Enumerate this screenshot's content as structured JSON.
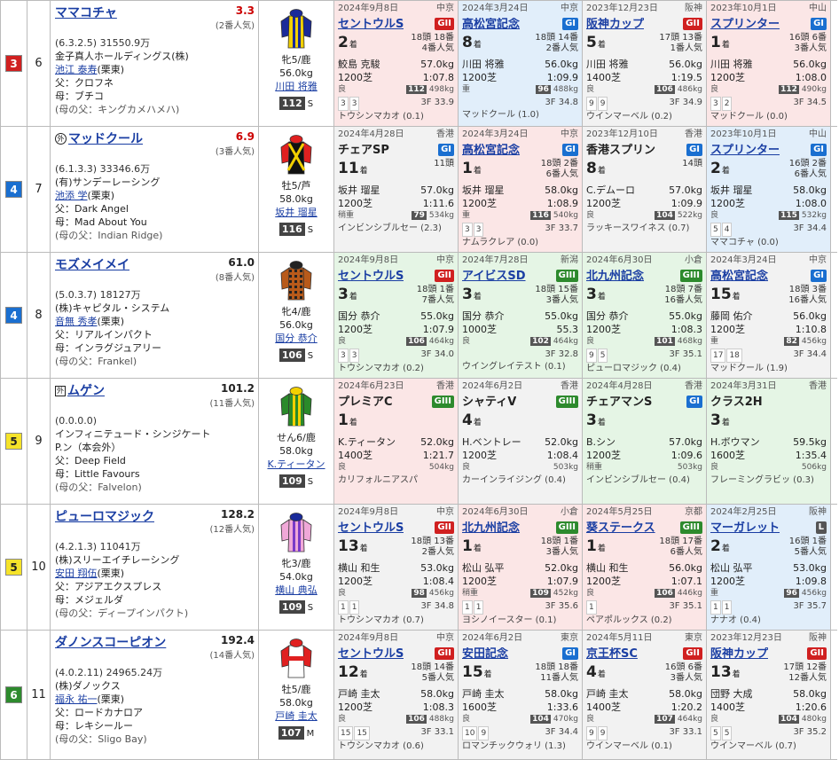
{
  "horses": [
    {
      "waku": "3",
      "waku_bg": "#d02020",
      "waku_fg": "#fff",
      "uma": "6",
      "name": "ママコチャ",
      "gaikoku": "",
      "odds": "3.3",
      "odds_red": true,
      "ninki": "(2番人気)",
      "record": "(6.3.2.5)",
      "prize": "31550.9万",
      "owner": "金子真人ホールディングス(株)",
      "trainer": "池江 泰寿",
      "region": "(栗東)",
      "sire": "父：クロフネ",
      "dam": "母：ブチコ",
      "damsire": "(母の父：キングカメハメハ)",
      "sexage": "牝5/鹿",
      "weight": "56.0kg",
      "jockey": "川田 将雅",
      "rating": "112",
      "rating_suffix": "S",
      "silk": {
        "body": "#f2d000",
        "sleeve": "#1a2a9a",
        "cap": "#1a2a9a",
        "pattern": "stripe",
        "stripe": "#1a2a9a"
      },
      "past": [
        {
          "date": "2024年9月8日",
          "venue": "中京",
          "race": "セントウルS",
          "grade": "GII",
          "g": "g2",
          "bg": "bg-red",
          "link": true,
          "pos": "2",
          "fs_line1": "18頭 18番",
          "fs_line2": "4番人気",
          "jockey": "鮫島 克駿",
          "kg": "57.0kg",
          "dist": "1200芝",
          "time": "1:07.8",
          "track": "良",
          "w_badge": "112",
          "bw": "498kg",
          "c1": "3",
          "c2": "3",
          "last3f": "3F 33.9",
          "winner": "トウシンマカオ (0.1)"
        },
        {
          "date": "2024年3月24日",
          "venue": "中京",
          "race": "高松宮記念",
          "grade": "GI",
          "g": "g1",
          "bg": "bg-blue",
          "link": true,
          "pos": "8",
          "fs_line1": "18頭 14番",
          "fs_line2": "2番人気",
          "jockey": "川田 将雅",
          "kg": "56.0kg",
          "dist": "1200芝",
          "time": "1:09.9",
          "track": "重",
          "w_badge": "96",
          "bw": "488kg",
          "c1": "",
          "c2": "",
          "last3f": "3F 34.8",
          "winner": "マッドクール (1.0)"
        },
        {
          "date": "2023年12月23日",
          "venue": "阪神",
          "race": "阪神カップ",
          "grade": "GII",
          "g": "g2",
          "bg": "bg-gray",
          "link": true,
          "pos": "5",
          "fs_line1": "17頭 13番",
          "fs_line2": "1番人気",
          "jockey": "川田 将雅",
          "kg": "56.0kg",
          "dist": "1400芝",
          "time": "1:19.5",
          "track": "良",
          "w_badge": "106",
          "bw": "486kg",
          "c1": "9",
          "c2": "9",
          "last3f": "3F 34.9",
          "winner": "ウインマーベル (0.2)"
        },
        {
          "date": "2023年10月1日",
          "venue": "中山",
          "race": "スプリンター",
          "grade": "GI",
          "g": "g1",
          "bg": "bg-red",
          "link": true,
          "pos": "1",
          "fs_line1": "16頭 6番",
          "fs_line2": "3番人気",
          "jockey": "川田 将雅",
          "kg": "56.0kg",
          "dist": "1200芝",
          "time": "1:08.0",
          "track": "良",
          "w_badge": "112",
          "bw": "490kg",
          "c1": "3",
          "c2": "2",
          "last3f": "3F 34.5",
          "winner": "マッドクール (0.0)"
        }
      ]
    },
    {
      "waku": "4",
      "waku_bg": "#1a6fd0",
      "waku_fg": "#fff",
      "uma": "7",
      "name": "マッドクール",
      "gaikoku": "circle",
      "odds": "6.9",
      "odds_red": true,
      "ninki": "(3番人気)",
      "record": "(6.1.3.3)",
      "prize": "33346.6万",
      "owner": "(有)サンデーレーシング",
      "trainer": "池添 学",
      "region": "(栗東)",
      "sire": "父：Dark Angel",
      "dam": "母：Mad About You",
      "damsire": "(母の父：Indian Ridge)",
      "sexage": "牡5/芦",
      "weight": "58.0kg",
      "jockey": "坂井 瑠星",
      "rating": "116",
      "rating_suffix": "S",
      "silk": {
        "body": "#111",
        "sleeve": "#e02020",
        "cap": "#e02020",
        "pattern": "cross",
        "stripe": "#f2d000"
      },
      "past": [
        {
          "date": "2024年4月28日",
          "venue": "香港",
          "race": "チェアSP",
          "grade": "GI",
          "g": "g1",
          "bg": "bg-gray",
          "link": false,
          "pos": "11",
          "fs_line1": "11頭",
          "fs_line2": "",
          "jockey": "坂井 瑠星",
          "kg": "57.0kg",
          "dist": "1200芝",
          "time": "1:11.6",
          "track": "稍重",
          "w_badge": "79",
          "bw": "534kg",
          "c1": "",
          "c2": "",
          "last3f": "",
          "winner": "インビンシブルセー (2.3)"
        },
        {
          "date": "2024年3月24日",
          "venue": "中京",
          "race": "高松宮記念",
          "grade": "GI",
          "g": "g1",
          "bg": "bg-red",
          "link": true,
          "pos": "1",
          "fs_line1": "18頭 2番",
          "fs_line2": "6番人気",
          "jockey": "坂井 瑠星",
          "kg": "58.0kg",
          "dist": "1200芝",
          "time": "1:08.9",
          "track": "重",
          "w_badge": "116",
          "bw": "540kg",
          "c1": "3",
          "c2": "3",
          "last3f": "3F 33.7",
          "winner": "ナムラクレア (0.0)"
        },
        {
          "date": "2023年12月10日",
          "venue": "香港",
          "race": "香港スプリン",
          "grade": "GI",
          "g": "g1",
          "bg": "bg-gray",
          "link": false,
          "pos": "8",
          "fs_line1": "14頭",
          "fs_line2": "",
          "jockey": "C.デムーロ",
          "kg": "57.0kg",
          "dist": "1200芝",
          "time": "1:09.9",
          "track": "良",
          "w_badge": "104",
          "bw": "522kg",
          "c1": "",
          "c2": "",
          "last3f": "",
          "winner": "ラッキースワイネス (0.7)"
        },
        {
          "date": "2023年10月1日",
          "venue": "中山",
          "race": "スプリンター",
          "grade": "GI",
          "g": "g1",
          "bg": "bg-blue",
          "link": true,
          "pos": "2",
          "fs_line1": "16頭 2番",
          "fs_line2": "6番人気",
          "jockey": "坂井 瑠星",
          "kg": "58.0kg",
          "dist": "1200芝",
          "time": "1:08.0",
          "track": "良",
          "w_badge": "115",
          "bw": "532kg",
          "c1": "5",
          "c2": "4",
          "last3f": "3F 34.4",
          "winner": "ママコチャ (0.0)"
        }
      ]
    },
    {
      "waku": "4",
      "waku_bg": "#1a6fd0",
      "waku_fg": "#fff",
      "uma": "8",
      "name": "モズメイメイ",
      "gaikoku": "",
      "odds": "61.0",
      "odds_red": false,
      "ninki": "(8番人気)",
      "record": "(5.0.3.7)",
      "prize": "18127万",
      "owner": "(株)キャピタル・システム",
      "trainer": "音無 秀孝",
      "region": "(栗東)",
      "sire": "父：リアルインパクト",
      "dam": "母：インラグジュアリー",
      "damsire": "(母の父：Frankel)",
      "sexage": "牝4/鹿",
      "weight": "56.0kg",
      "jockey": "国分 恭介",
      "rating": "106",
      "rating_suffix": "S",
      "silk": {
        "body": "#b85a1a",
        "sleeve": "#b85a1a",
        "cap": "#222",
        "pattern": "check",
        "stripe": "#222"
      },
      "past": [
        {
          "date": "2024年9月8日",
          "venue": "中京",
          "race": "セントウルS",
          "grade": "GII",
          "g": "g2",
          "bg": "bg-green",
          "link": true,
          "pos": "3",
          "fs_line1": "18頭 1番",
          "fs_line2": "7番人気",
          "jockey": "国分 恭介",
          "kg": "55.0kg",
          "dist": "1200芝",
          "time": "1:07.9",
          "track": "良",
          "w_badge": "106",
          "bw": "464kg",
          "c1": "3",
          "c2": "3",
          "last3f": "3F 34.0",
          "winner": "トウシンマカオ (0.2)"
        },
        {
          "date": "2024年7月28日",
          "venue": "新潟",
          "race": "アイビスSD",
          "grade": "GIII",
          "g": "g3",
          "bg": "bg-green",
          "link": true,
          "pos": "3",
          "fs_line1": "18頭 15番",
          "fs_line2": "3番人気",
          "jockey": "国分 恭介",
          "kg": "55.0kg",
          "dist": "1000芝",
          "time": "55.3",
          "track": "良",
          "w_badge": "102",
          "bw": "464kg",
          "c1": "",
          "c2": "",
          "last3f": "3F 32.8",
          "winner": "ウイングレイテスト (0.1)"
        },
        {
          "date": "2024年6月30日",
          "venue": "小倉",
          "race": "北九州記念",
          "grade": "GIII",
          "g": "g3",
          "bg": "bg-green",
          "link": true,
          "pos": "3",
          "fs_line1": "18頭 7番",
          "fs_line2": "16番人気",
          "jockey": "国分 恭介",
          "kg": "55.0kg",
          "dist": "1200芝",
          "time": "1:08.3",
          "track": "良",
          "w_badge": "101",
          "bw": "468kg",
          "c1": "9",
          "c2": "5",
          "last3f": "3F 35.1",
          "winner": "ピューロマジック (0.4)"
        },
        {
          "date": "2024年3月24日",
          "venue": "中京",
          "race": "高松宮記念",
          "grade": "GI",
          "g": "g1",
          "bg": "bg-gray",
          "link": true,
          "pos": "15",
          "fs_line1": "18頭 3番",
          "fs_line2": "16番人気",
          "jockey": "藤岡 佑介",
          "kg": "56.0kg",
          "dist": "1200芝",
          "time": "1:10.8",
          "track": "重",
          "w_badge": "82",
          "bw": "456kg",
          "c1": "17",
          "c2": "18",
          "last3f": "3F 34.4",
          "winner": "マッドクール (1.9)"
        }
      ]
    },
    {
      "waku": "5",
      "waku_bg": "#f5e32a",
      "waku_fg": "#222",
      "uma": "9",
      "name": "ムゲン",
      "gaikoku": "box",
      "odds": "101.2",
      "odds_red": false,
      "ninki": "(11番人気)",
      "record": "(0.0.0.0)",
      "prize": "",
      "owner": "インフィニテュード・シンジケート",
      "trainer": "",
      "region": "P.ン（本会外）",
      "sire": "父：Deep Field",
      "dam": "母：Little Favours",
      "damsire": "(母の父：Falvelon)",
      "sexage": "せん6/鹿",
      "weight": "58.0kg",
      "jockey": "K.ティータン",
      "rating": "109",
      "rating_suffix": "S",
      "silk": {
        "body": "#2a8a2a",
        "sleeve": "#2a8a2a",
        "cap": "#f2d000",
        "pattern": "stripe",
        "stripe": "#f2d000"
      },
      "past": [
        {
          "date": "2024年6月23日",
          "venue": "香港",
          "race": "プレミアC",
          "grade": "GIII",
          "g": "g3",
          "bg": "bg-red",
          "link": false,
          "pos": "1",
          "fs_line1": "",
          "fs_line2": "",
          "jockey": "K.ティータン",
          "kg": "52.0kg",
          "dist": "1400芝",
          "time": "1:21.7",
          "track": "良",
          "w_badge": "",
          "bw": "504kg",
          "c1": "",
          "c2": "",
          "last3f": "",
          "winner": "カリフォルニアスパ"
        },
        {
          "date": "2024年6月2日",
          "venue": "香港",
          "race": "シャティV",
          "grade": "GIII",
          "g": "g3",
          "bg": "bg-gray",
          "link": false,
          "pos": "4",
          "fs_line1": "",
          "fs_line2": "",
          "jockey": "H.ベントレー",
          "kg": "52.0kg",
          "dist": "1200芝",
          "time": "1:08.4",
          "track": "良",
          "w_badge": "",
          "bw": "503kg",
          "c1": "",
          "c2": "",
          "last3f": "",
          "winner": "カーインライジング (0.4)"
        },
        {
          "date": "2024年4月28日",
          "venue": "香港",
          "race": "チェアマンS",
          "grade": "GI",
          "g": "g1",
          "bg": "bg-green",
          "link": false,
          "pos": "3",
          "fs_line1": "",
          "fs_line2": "",
          "jockey": "B.シン",
          "kg": "57.0kg",
          "dist": "1200芝",
          "time": "1:09.6",
          "track": "稍重",
          "w_badge": "",
          "bw": "503kg",
          "c1": "",
          "c2": "",
          "last3f": "",
          "winner": "インビンシブルセー (0.4)"
        },
        {
          "date": "2024年3月31日",
          "venue": "香港",
          "race": "クラス2H",
          "grade": "",
          "g": "",
          "bg": "bg-green",
          "link": false,
          "pos": "3",
          "fs_line1": "",
          "fs_line2": "",
          "jockey": "H.ボウマン",
          "kg": "59.5kg",
          "dist": "1600芝",
          "time": "1:35.4",
          "track": "良",
          "w_badge": "",
          "bw": "506kg",
          "c1": "",
          "c2": "",
          "last3f": "",
          "winner": "フレーミングラビッ (0.3)"
        }
      ]
    },
    {
      "waku": "5",
      "waku_bg": "#f5e32a",
      "waku_fg": "#222",
      "uma": "10",
      "name": "ピューロマジック",
      "gaikoku": "",
      "odds": "128.2",
      "odds_red": false,
      "ninki": "(12番人気)",
      "record": "(4.2.1.3)",
      "prize": "11041万",
      "owner": "(株)スリーエイチレーシング",
      "trainer": "安田 翔伍",
      "region": "(栗東)",
      "sire": "父：アジアエクスプレス",
      "dam": "母：メジェルダ",
      "damsire": "(母の父：ディープインパクト)",
      "sexage": "牝3/鹿",
      "weight": "54.0kg",
      "jockey": "横山 典弘",
      "rating": "109",
      "rating_suffix": "S",
      "silk": {
        "body": "#f0a8d8",
        "sleeve": "#f0a8d8",
        "cap": "#1a2a9a",
        "pattern": "stripe",
        "stripe": "#7a3ac8"
      },
      "past": [
        {
          "date": "2024年9月8日",
          "venue": "中京",
          "race": "セントウルS",
          "grade": "GII",
          "g": "g2",
          "bg": "bg-gray",
          "link": true,
          "pos": "13",
          "fs_line1": "18頭 13番",
          "fs_line2": "2番人気",
          "jockey": "横山 和生",
          "kg": "53.0kg",
          "dist": "1200芝",
          "time": "1:08.4",
          "track": "良",
          "w_badge": "98",
          "bw": "456kg",
          "c1": "1",
          "c2": "1",
          "last3f": "3F 34.8",
          "winner": "トウシンマカオ (0.7)"
        },
        {
          "date": "2024年6月30日",
          "venue": "小倉",
          "race": "北九州記念",
          "grade": "GIII",
          "g": "g3",
          "bg": "bg-red",
          "link": true,
          "pos": "1",
          "fs_line1": "18頭 1番",
          "fs_line2": "3番人気",
          "jockey": "松山 弘平",
          "kg": "52.0kg",
          "dist": "1200芝",
          "time": "1:07.9",
          "track": "稍重",
          "w_badge": "109",
          "bw": "452kg",
          "c1": "1",
          "c2": "1",
          "last3f": "3F 35.6",
          "winner": "ヨシノイースター (0.1)"
        },
        {
          "date": "2024年5月25日",
          "venue": "京都",
          "race": "葵ステークス",
          "grade": "GIII",
          "g": "g3",
          "bg": "bg-red",
          "link": true,
          "pos": "1",
          "fs_line1": "18頭 17番",
          "fs_line2": "6番人気",
          "jockey": "横山 和生",
          "kg": "56.0kg",
          "dist": "1200芝",
          "time": "1:07.1",
          "track": "良",
          "w_badge": "106",
          "bw": "446kg",
          "c1": "1",
          "c2": "",
          "last3f": "3F 35.1",
          "winner": "ペアポルックス (0.2)"
        },
        {
          "date": "2024年2月25日",
          "venue": "阪神",
          "race": "マーガレット",
          "grade": "L",
          "g": "gL",
          "bg": "bg-blue",
          "link": true,
          "pos": "2",
          "fs_line1": "16頭 1番",
          "fs_line2": "5番人気",
          "jockey": "松山 弘平",
          "kg": "53.0kg",
          "dist": "1200芝",
          "time": "1:09.8",
          "track": "重",
          "w_badge": "96",
          "bw": "456kg",
          "c1": "1",
          "c2": "1",
          "last3f": "3F 35.7",
          "winner": "ナナオ (0.4)"
        }
      ]
    },
    {
      "waku": "6",
      "waku_bg": "#2d8a2d",
      "waku_fg": "#fff",
      "uma": "11",
      "name": "ダノンスコーピオン",
      "gaikoku": "",
      "odds": "192.4",
      "odds_red": false,
      "ninki": "(14番人気)",
      "record": "(4.0.2.11)",
      "prize": "24965.24万",
      "owner": "(株)ダノックス",
      "trainer": "福永 祐一",
      "region": "(栗東)",
      "sire": "父：ロードカナロア",
      "dam": "母：レキシールー",
      "damsire": "(母の父：Sligo Bay)",
      "sexage": "牡5/鹿",
      "weight": "58.0kg",
      "jockey": "戸崎 圭太",
      "rating": "107",
      "rating_suffix": "M",
      "silk": {
        "body": "#fff",
        "sleeve": "#e02020",
        "cap": "#e02020",
        "pattern": "band",
        "stripe": "#e02020"
      },
      "past": [
        {
          "date": "2024年9月8日",
          "venue": "中京",
          "race": "セントウルS",
          "grade": "GII",
          "g": "g2",
          "bg": "bg-gray",
          "link": true,
          "pos": "12",
          "fs_line1": "18頭 14番",
          "fs_line2": "5番人気",
          "jockey": "戸崎 圭太",
          "kg": "58.0kg",
          "dist": "1200芝",
          "time": "1:08.3",
          "track": "良",
          "w_badge": "106",
          "bw": "488kg",
          "c1": "15",
          "c2": "15",
          "last3f": "3F 33.1",
          "winner": "トウシンマカオ (0.6)"
        },
        {
          "date": "2024年6月2日",
          "venue": "東京",
          "race": "安田記念",
          "grade": "GI",
          "g": "g1",
          "bg": "bg-gray",
          "link": true,
          "pos": "15",
          "fs_line1": "18頭 18番",
          "fs_line2": "11番人気",
          "jockey": "戸崎 圭太",
          "kg": "58.0kg",
          "dist": "1600芝",
          "time": "1:33.6",
          "track": "良",
          "w_badge": "104",
          "bw": "470kg",
          "c1": "10",
          "c2": "9",
          "last3f": "3F 34.4",
          "winner": "ロマンチックウォリ (1.3)"
        },
        {
          "date": "2024年5月11日",
          "venue": "東京",
          "race": "京王杯SC",
          "grade": "GII",
          "g": "g2",
          "bg": "bg-gray",
          "link": true,
          "pos": "4",
          "fs_line1": "16頭 6番",
          "fs_line2": "3番人気",
          "jockey": "戸崎 圭太",
          "kg": "58.0kg",
          "dist": "1400芝",
          "time": "1:20.2",
          "track": "良",
          "w_badge": "107",
          "bw": "464kg",
          "c1": "9",
          "c2": "9",
          "last3f": "3F 33.1",
          "winner": "ウインマーベル (0.1)"
        },
        {
          "date": "2023年12月23日",
          "venue": "阪神",
          "race": "阪神カップ",
          "grade": "GII",
          "g": "g2",
          "bg": "bg-gray",
          "link": true,
          "pos": "13",
          "fs_line1": "17頭 12番",
          "fs_line2": "12番人気",
          "jockey": "団野 大成",
          "kg": "58.0kg",
          "dist": "1400芝",
          "time": "1:20.6",
          "track": "良",
          "w_badge": "104",
          "bw": "480kg",
          "c1": "5",
          "c2": "5",
          "last3f": "3F 35.2",
          "winner": "ウインマーベル (0.7)"
        }
      ]
    }
  ],
  "labels": {
    "chaku": "着"
  }
}
